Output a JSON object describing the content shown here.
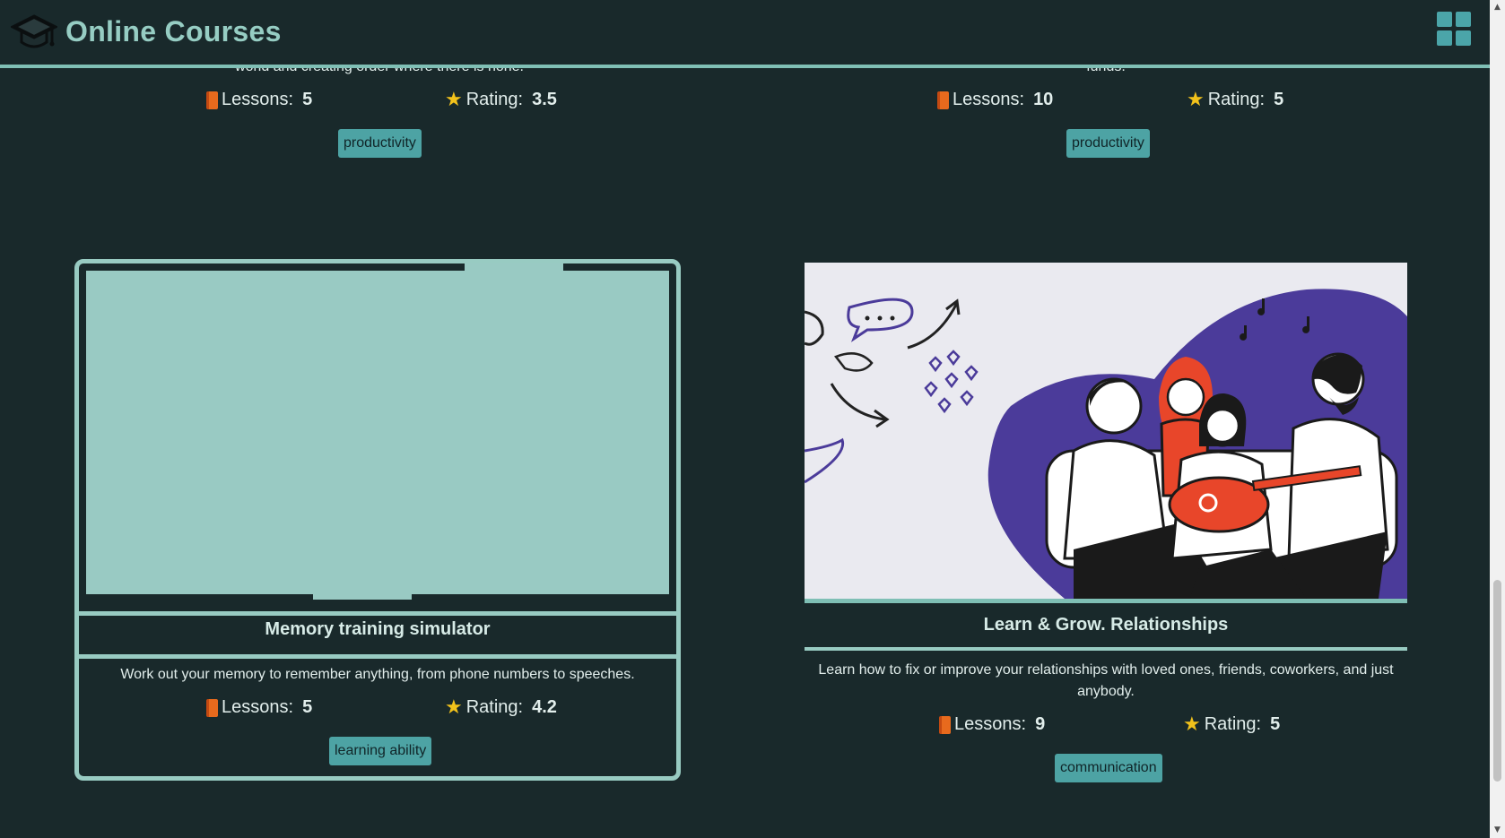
{
  "app": {
    "title": "Online Courses",
    "menu_icon": "grid-icon",
    "logo_icon": "graduation-cap-icon"
  },
  "colors": {
    "background": "#19292b",
    "accent": "#96cdc3",
    "tag": "#4da3a4",
    "book": "#e86a1d",
    "star": "#f2c21b"
  },
  "labels": {
    "lessons": "Lessons:",
    "rating": "Rating:"
  },
  "courses": [
    {
      "description_clipped": "world and creating order where there is none.",
      "lessons": "5",
      "rating": "3.5",
      "tag": "productivity"
    },
    {
      "description_clipped": "funds.",
      "lessons": "10",
      "rating": "5",
      "tag": "productivity"
    },
    {
      "title": "Memory training simulator",
      "description": "Work out your memory to remember anything, from phone numbers to speeches.",
      "lessons": "5",
      "rating": "4.2",
      "tag": "learning ability"
    },
    {
      "title": "Learn & Grow. Relationships",
      "description": "Learn how to fix or improve your relationships with loved ones, friends, coworkers, and just anybody.",
      "lessons": "9",
      "rating": "5",
      "tag": "communication"
    }
  ]
}
